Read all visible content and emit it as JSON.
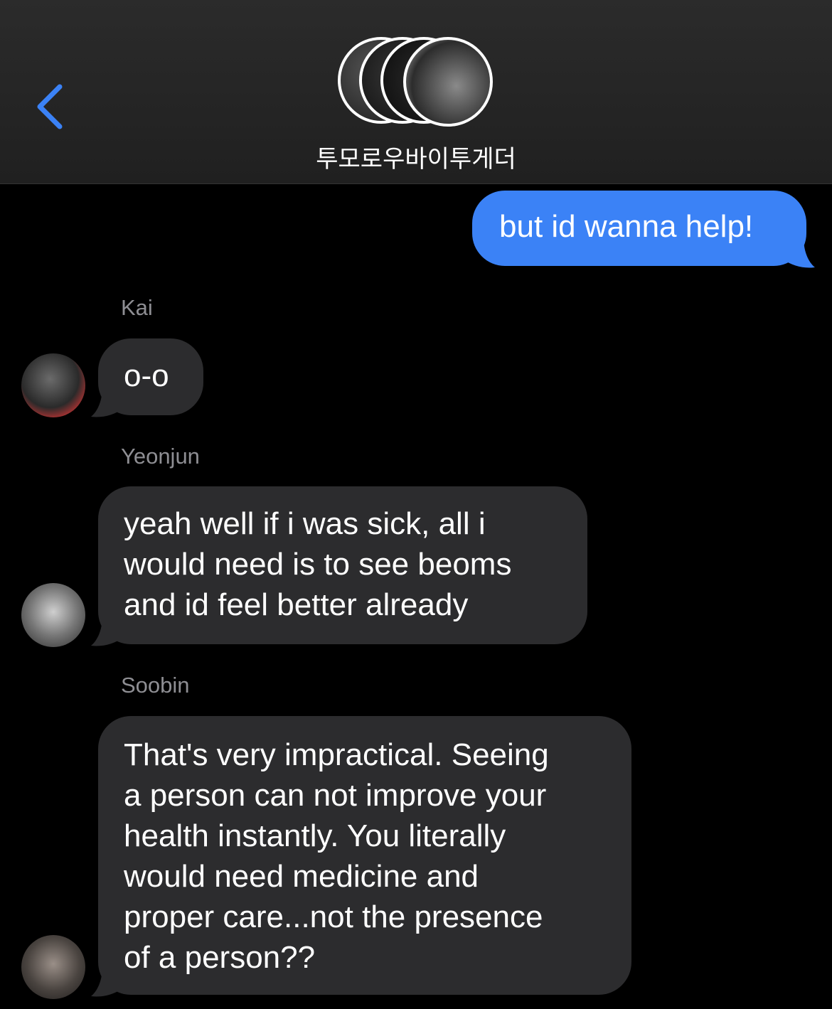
{
  "header": {
    "group_name": "투모로우바이투게더",
    "back_icon": "chevron-left-icon",
    "accent_color": "#3b82f6"
  },
  "messages": [
    {
      "direction": "outgoing",
      "text": "but id wanna help!"
    },
    {
      "direction": "incoming",
      "sender": "Kai",
      "text": "o-o"
    },
    {
      "direction": "incoming",
      "sender": "Yeonjun",
      "lines": [
        "yeah well if i was sick, all i",
        "would need is to see beoms",
        "and id feel better already"
      ]
    },
    {
      "direction": "incoming",
      "sender": "Soobin",
      "lines": [
        "That's very impractical. Seeing",
        "a person can not improve your",
        "health instantly. You literally",
        "would need medicine and",
        "proper care...not the presence",
        "of a person??"
      ]
    }
  ]
}
